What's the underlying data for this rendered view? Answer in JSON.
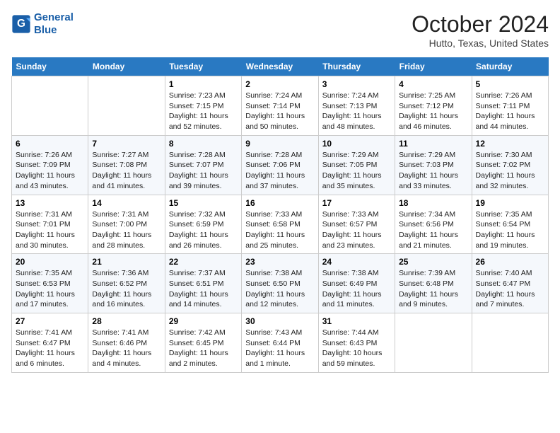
{
  "header": {
    "logo_line1": "General",
    "logo_line2": "Blue",
    "month": "October 2024",
    "location": "Hutto, Texas, United States"
  },
  "weekdays": [
    "Sunday",
    "Monday",
    "Tuesday",
    "Wednesday",
    "Thursday",
    "Friday",
    "Saturday"
  ],
  "weeks": [
    [
      {
        "day": "",
        "sunrise": "",
        "sunset": "",
        "daylight": ""
      },
      {
        "day": "",
        "sunrise": "",
        "sunset": "",
        "daylight": ""
      },
      {
        "day": "1",
        "sunrise": "Sunrise: 7:23 AM",
        "sunset": "Sunset: 7:15 PM",
        "daylight": "Daylight: 11 hours and 52 minutes."
      },
      {
        "day": "2",
        "sunrise": "Sunrise: 7:24 AM",
        "sunset": "Sunset: 7:14 PM",
        "daylight": "Daylight: 11 hours and 50 minutes."
      },
      {
        "day": "3",
        "sunrise": "Sunrise: 7:24 AM",
        "sunset": "Sunset: 7:13 PM",
        "daylight": "Daylight: 11 hours and 48 minutes."
      },
      {
        "day": "4",
        "sunrise": "Sunrise: 7:25 AM",
        "sunset": "Sunset: 7:12 PM",
        "daylight": "Daylight: 11 hours and 46 minutes."
      },
      {
        "day": "5",
        "sunrise": "Sunrise: 7:26 AM",
        "sunset": "Sunset: 7:11 PM",
        "daylight": "Daylight: 11 hours and 44 minutes."
      }
    ],
    [
      {
        "day": "6",
        "sunrise": "Sunrise: 7:26 AM",
        "sunset": "Sunset: 7:09 PM",
        "daylight": "Daylight: 11 hours and 43 minutes."
      },
      {
        "day": "7",
        "sunrise": "Sunrise: 7:27 AM",
        "sunset": "Sunset: 7:08 PM",
        "daylight": "Daylight: 11 hours and 41 minutes."
      },
      {
        "day": "8",
        "sunrise": "Sunrise: 7:28 AM",
        "sunset": "Sunset: 7:07 PM",
        "daylight": "Daylight: 11 hours and 39 minutes."
      },
      {
        "day": "9",
        "sunrise": "Sunrise: 7:28 AM",
        "sunset": "Sunset: 7:06 PM",
        "daylight": "Daylight: 11 hours and 37 minutes."
      },
      {
        "day": "10",
        "sunrise": "Sunrise: 7:29 AM",
        "sunset": "Sunset: 7:05 PM",
        "daylight": "Daylight: 11 hours and 35 minutes."
      },
      {
        "day": "11",
        "sunrise": "Sunrise: 7:29 AM",
        "sunset": "Sunset: 7:03 PM",
        "daylight": "Daylight: 11 hours and 33 minutes."
      },
      {
        "day": "12",
        "sunrise": "Sunrise: 7:30 AM",
        "sunset": "Sunset: 7:02 PM",
        "daylight": "Daylight: 11 hours and 32 minutes."
      }
    ],
    [
      {
        "day": "13",
        "sunrise": "Sunrise: 7:31 AM",
        "sunset": "Sunset: 7:01 PM",
        "daylight": "Daylight: 11 hours and 30 minutes."
      },
      {
        "day": "14",
        "sunrise": "Sunrise: 7:31 AM",
        "sunset": "Sunset: 7:00 PM",
        "daylight": "Daylight: 11 hours and 28 minutes."
      },
      {
        "day": "15",
        "sunrise": "Sunrise: 7:32 AM",
        "sunset": "Sunset: 6:59 PM",
        "daylight": "Daylight: 11 hours and 26 minutes."
      },
      {
        "day": "16",
        "sunrise": "Sunrise: 7:33 AM",
        "sunset": "Sunset: 6:58 PM",
        "daylight": "Daylight: 11 hours and 25 minutes."
      },
      {
        "day": "17",
        "sunrise": "Sunrise: 7:33 AM",
        "sunset": "Sunset: 6:57 PM",
        "daylight": "Daylight: 11 hours and 23 minutes."
      },
      {
        "day": "18",
        "sunrise": "Sunrise: 7:34 AM",
        "sunset": "Sunset: 6:56 PM",
        "daylight": "Daylight: 11 hours and 21 minutes."
      },
      {
        "day": "19",
        "sunrise": "Sunrise: 7:35 AM",
        "sunset": "Sunset: 6:54 PM",
        "daylight": "Daylight: 11 hours and 19 minutes."
      }
    ],
    [
      {
        "day": "20",
        "sunrise": "Sunrise: 7:35 AM",
        "sunset": "Sunset: 6:53 PM",
        "daylight": "Daylight: 11 hours and 17 minutes."
      },
      {
        "day": "21",
        "sunrise": "Sunrise: 7:36 AM",
        "sunset": "Sunset: 6:52 PM",
        "daylight": "Daylight: 11 hours and 16 minutes."
      },
      {
        "day": "22",
        "sunrise": "Sunrise: 7:37 AM",
        "sunset": "Sunset: 6:51 PM",
        "daylight": "Daylight: 11 hours and 14 minutes."
      },
      {
        "day": "23",
        "sunrise": "Sunrise: 7:38 AM",
        "sunset": "Sunset: 6:50 PM",
        "daylight": "Daylight: 11 hours and 12 minutes."
      },
      {
        "day": "24",
        "sunrise": "Sunrise: 7:38 AM",
        "sunset": "Sunset: 6:49 PM",
        "daylight": "Daylight: 11 hours and 11 minutes."
      },
      {
        "day": "25",
        "sunrise": "Sunrise: 7:39 AM",
        "sunset": "Sunset: 6:48 PM",
        "daylight": "Daylight: 11 hours and 9 minutes."
      },
      {
        "day": "26",
        "sunrise": "Sunrise: 7:40 AM",
        "sunset": "Sunset: 6:47 PM",
        "daylight": "Daylight: 11 hours and 7 minutes."
      }
    ],
    [
      {
        "day": "27",
        "sunrise": "Sunrise: 7:41 AM",
        "sunset": "Sunset: 6:47 PM",
        "daylight": "Daylight: 11 hours and 6 minutes."
      },
      {
        "day": "28",
        "sunrise": "Sunrise: 7:41 AM",
        "sunset": "Sunset: 6:46 PM",
        "daylight": "Daylight: 11 hours and 4 minutes."
      },
      {
        "day": "29",
        "sunrise": "Sunrise: 7:42 AM",
        "sunset": "Sunset: 6:45 PM",
        "daylight": "Daylight: 11 hours and 2 minutes."
      },
      {
        "day": "30",
        "sunrise": "Sunrise: 7:43 AM",
        "sunset": "Sunset: 6:44 PM",
        "daylight": "Daylight: 11 hours and 1 minute."
      },
      {
        "day": "31",
        "sunrise": "Sunrise: 7:44 AM",
        "sunset": "Sunset: 6:43 PM",
        "daylight": "Daylight: 10 hours and 59 minutes."
      },
      {
        "day": "",
        "sunrise": "",
        "sunset": "",
        "daylight": ""
      },
      {
        "day": "",
        "sunrise": "",
        "sunset": "",
        "daylight": ""
      }
    ]
  ]
}
